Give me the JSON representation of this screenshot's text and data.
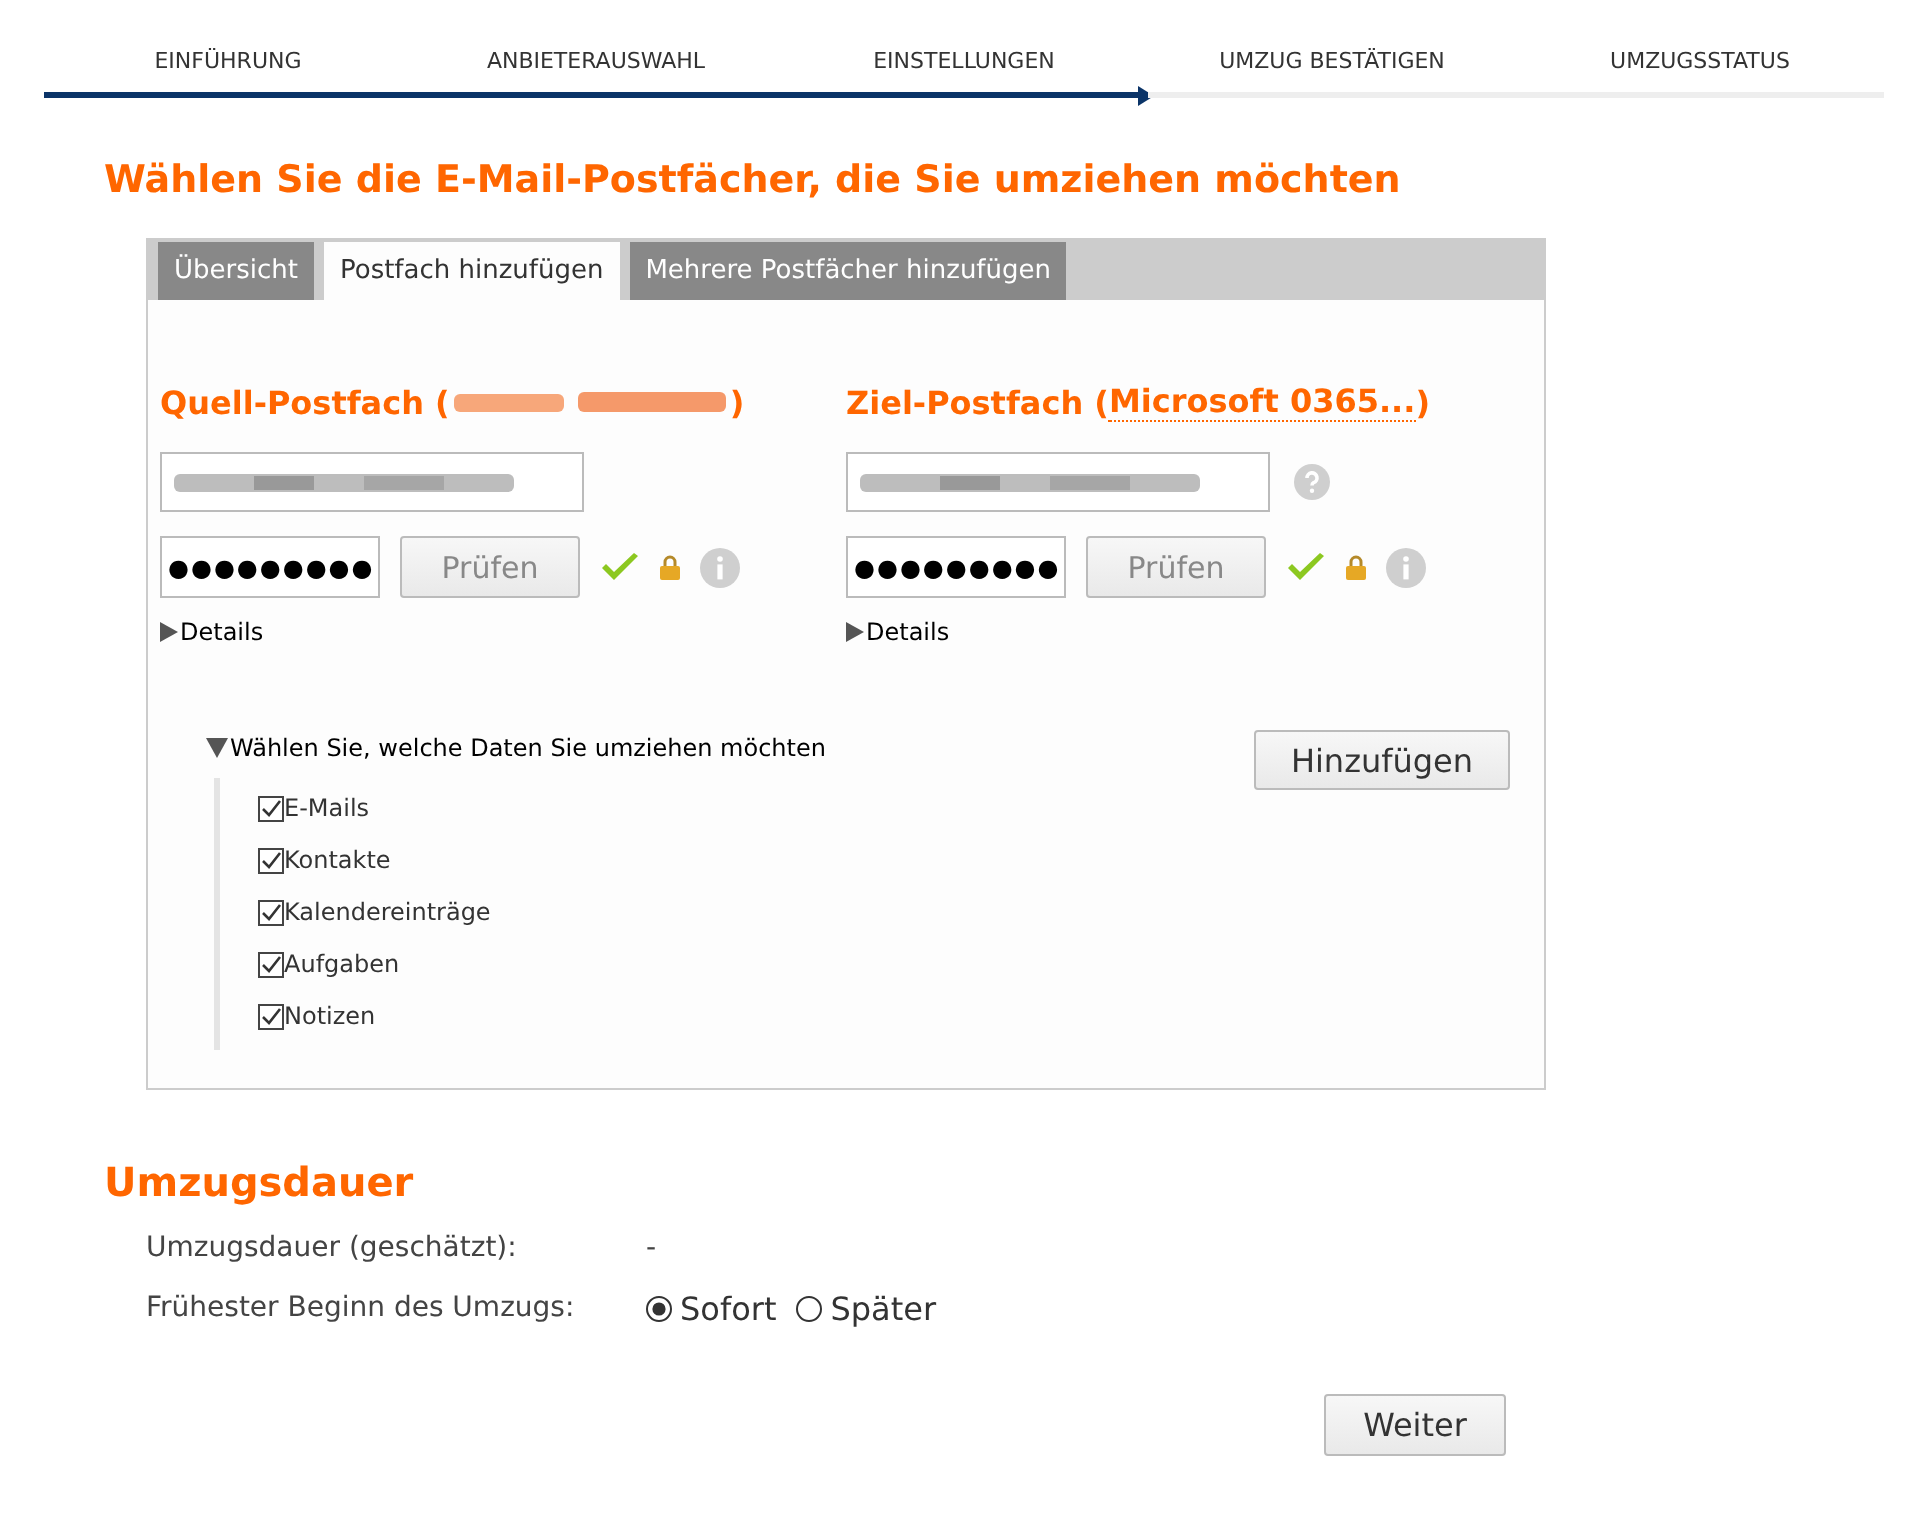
{
  "steps": [
    {
      "label": "EINFÜHRUNG",
      "completed": true
    },
    {
      "label": "ANBIETERAUSWAHL",
      "completed": true
    },
    {
      "label": "EINSTELLUNGEN",
      "completed": true
    },
    {
      "label": "UMZUG BESTÄTIGEN",
      "completed": false
    },
    {
      "label": "UMZUGSSTATUS",
      "completed": false
    }
  ],
  "heading": "Wählen Sie die E-Mail-Postfächer, die Sie umziehen möchten",
  "tabs": [
    {
      "label": "Übersicht",
      "selected": false
    },
    {
      "label": "Postfach hinzufügen",
      "selected": true
    },
    {
      "label": "Mehrere Postfächer hinzufügen",
      "selected": false
    }
  ],
  "mailboxes": [
    {
      "title": "Quell-Postfach (",
      "suffix": ")",
      "password": "●●●●●●●●●",
      "verify_button": "Prüfen",
      "verified": true,
      "details": {
        "label": "Details",
        "expanded": false
      }
    },
    {
      "title": "Ziel-Postfach (",
      "provider_link": "Microsoft 0365...",
      "suffix": ")",
      "password": "●●●●●●●●●",
      "verify_button": "Prüfen",
      "verified": true,
      "help_icon": true,
      "details": {
        "label": "Details",
        "expanded": false
      }
    }
  ],
  "data_section": {
    "label": "Wählen Sie, welche Daten Sie umziehen möchten",
    "expanded": true,
    "items": [
      {
        "label": "E-Mails",
        "checked": true
      },
      {
        "label": "Kontakte",
        "checked": true
      },
      {
        "label": "Kalendereinträge",
        "checked": true
      },
      {
        "label": "Aufgaben",
        "checked": true
      },
      {
        "label": "Notizen",
        "checked": true
      }
    ]
  },
  "add_button": "Hinzufügen",
  "duration": {
    "heading": "Umzugsdauer",
    "estimate_label": "Umzugsdauer (geschätzt):",
    "estimate_value": "-",
    "start_label": "Frühester Beginn des Umzugs:",
    "start_options": [
      {
        "label": "Sofort",
        "selected": true
      },
      {
        "label": "Später",
        "selected": false
      }
    ]
  },
  "next_button": "Weiter"
}
